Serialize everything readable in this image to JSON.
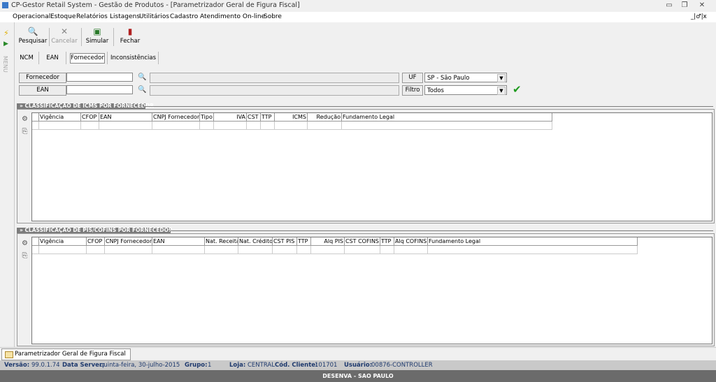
{
  "window": {
    "title": "CP-Gestor Retail System - Gestão de Produtos - [Parametrizador Geral de Figura Fiscal]",
    "minimize": "▭",
    "restore": "❐",
    "close": "✕",
    "mdi_controls": "_|♂|x"
  },
  "menu": [
    "Operacional",
    "Estoque",
    "Relatórios",
    "Listagens",
    "Utilitários",
    "Cadastro",
    "Atendimento On-line",
    "Sobre"
  ],
  "left_strip": {
    "label": "MENU"
  },
  "toolbar": {
    "pesquisar": "Pesquisar",
    "cancelar": "Cancelar",
    "simular": "Simular",
    "fechar": "Fechar"
  },
  "tabs": [
    "NCM",
    "EAN",
    "Fornecedor",
    "Inconsistências"
  ],
  "filters": {
    "fornecedor_label": "Fornecedor",
    "ean_label": "EAN",
    "uf_label": "UF",
    "uf_value": "SP - São Paulo",
    "filtro_label": "Filtro",
    "filtro_value": "Todos",
    "fornecedor_value": "",
    "ean_value": ""
  },
  "icms_section": {
    "title": "» CLASSIFICAÇÃO DE ICMS POR FORNECEDOR",
    "columns": [
      "Vigência",
      "CFOP",
      "EAN",
      "CNPJ Fornecedor",
      "Tipo",
      "IVA",
      "CST",
      "TTP",
      "ICMS",
      "Redução",
      "Fundamento Legal"
    ]
  },
  "pis_section": {
    "title": "» CLASSIFICAÇÃO DE PIS/COFINS POR FORNECEDOR",
    "columns": [
      "Vigência",
      "CFOP",
      "CNPJ Fornecedor",
      "EAN",
      "Nat. Receita",
      "Nat. Crédito",
      "CST PIS",
      "TTP",
      "Alq PIS",
      "CST COFINS",
      "TTP",
      "Alq COFINS",
      "Fundamento Legal"
    ]
  },
  "doc_tab": "Parametrizador Geral de Figura Fiscal",
  "status": {
    "versao_label": "Versão:",
    "versao": "99.0.1.74",
    "server_label": "Data Server:",
    "server": "quinta-feira, 30-julho-2015",
    "grupo_label": "Grupo:",
    "grupo": "1",
    "loja_label": "Loja:",
    "loja": "CENTRAL",
    "cliente_label": "Cód. Cliente:",
    "cliente": "101701",
    "usuario_label": "Usuário:",
    "usuario": "00876-CONTROLLER"
  },
  "footer": "DESENVA - SAO PAULO",
  "colors": {
    "accent": "#1f3a6e",
    "section_header": "#7b7b7b",
    "footer": "#6b6b6b"
  }
}
